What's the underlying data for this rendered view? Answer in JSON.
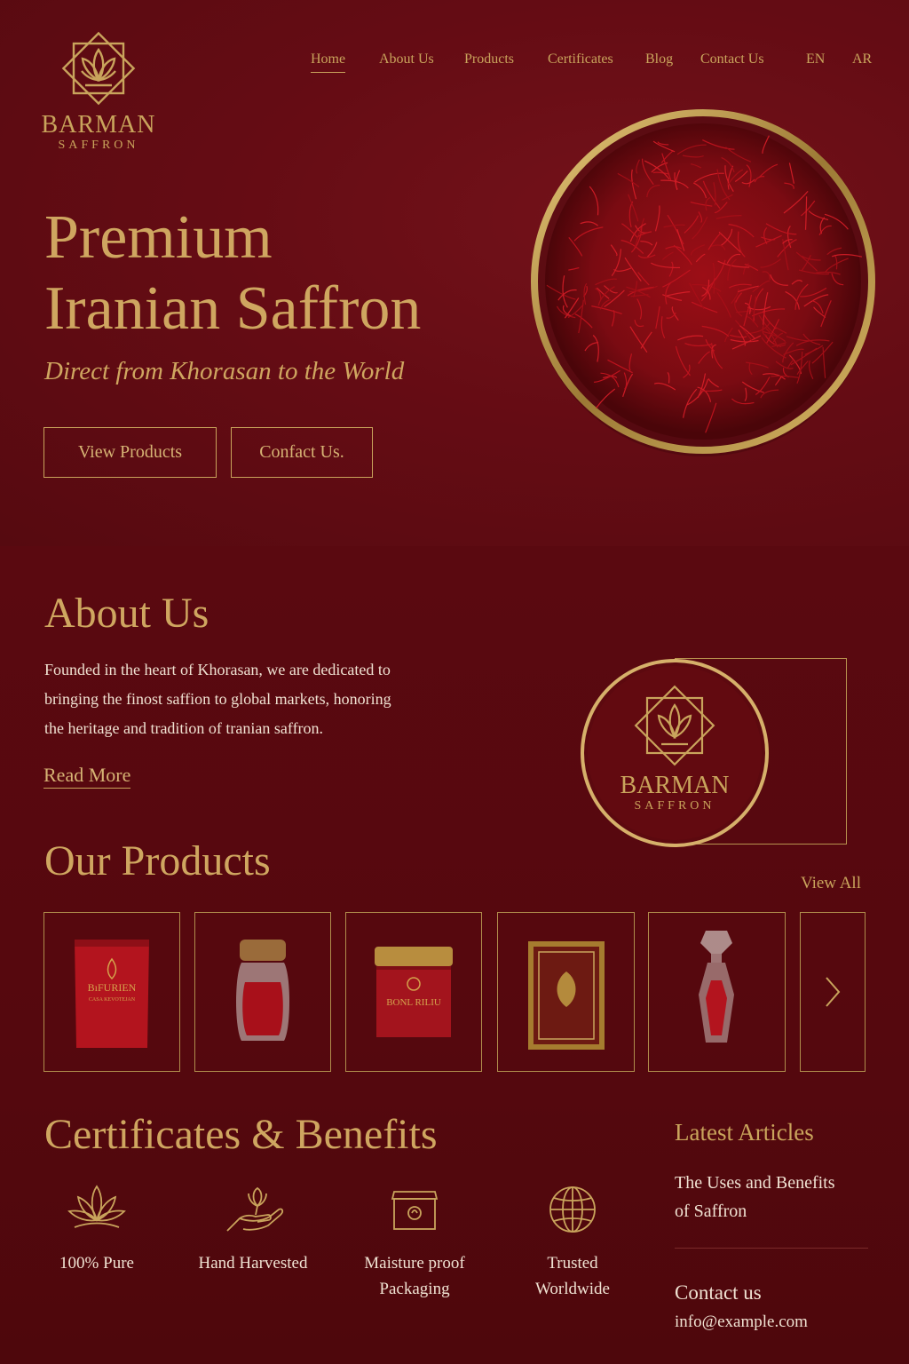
{
  "brand": {
    "name": "BARMAN",
    "tagline": "SAFFRON",
    "colors": {
      "gold": "#c9a45c",
      "maroon": "#5e0a0f",
      "saffron": "#b3141e",
      "text_light": "#f0e2d2"
    }
  },
  "nav": {
    "items": [
      {
        "label": "Home",
        "active": true
      },
      {
        "label": "About Us"
      },
      {
        "label": "Products"
      },
      {
        "label": "Certificates"
      },
      {
        "label": "Blog"
      },
      {
        "label": "Contact Us"
      }
    ],
    "languages": [
      "EN",
      "AR"
    ]
  },
  "hero": {
    "title_line1": "Premium",
    "title_line2": "Iranian Saffron",
    "subtitle": "Direct from Khorasan to the World",
    "buttons": {
      "view_products": "View Products",
      "contact": "Confact Us."
    },
    "image": "saffron-bowl"
  },
  "about": {
    "title": "About Us",
    "text_line1": "Founded in the heart of Khorasan, we are dedicated to",
    "text_line2": "bringing the finost saffion to global markets, honoring",
    "text_line3": "the heritage and tradition of tranian saffron.",
    "read_more": "Read More",
    "seal": {
      "name": "BARMAN",
      "tagline": "SAFFRON"
    }
  },
  "products": {
    "title": "Our Products",
    "view_all": "View All",
    "items": [
      {
        "type": "pouch",
        "label_line1": "BıFURIEN",
        "label_line2": "CASA KEVOTEJAN"
      },
      {
        "type": "glass-jar"
      },
      {
        "type": "tin",
        "label": "BONL RILIU"
      },
      {
        "type": "gift-box"
      },
      {
        "type": "crystal-vial"
      }
    ],
    "next_icon": "chevron-right-icon"
  },
  "certificates": {
    "title": "Certificates & Benefits",
    "items": [
      {
        "icon": "lotus-icon",
        "line1": "100% Pure",
        "line2": ""
      },
      {
        "icon": "hand-flower-icon",
        "line1": "Hand Harvested",
        "line2": ""
      },
      {
        "icon": "box-icon",
        "line1": "Maisture proof",
        "line2": "Packaging"
      },
      {
        "icon": "globe-icon",
        "line1": "Trusted",
        "line2": "Worldwide"
      }
    ]
  },
  "articles": {
    "title": "Latest Articles",
    "items": [
      {
        "line1": "The Uses and Benefits",
        "line2": "of Saffron"
      }
    ]
  },
  "contact": {
    "title": "Contact us",
    "email": "info@example.com"
  }
}
